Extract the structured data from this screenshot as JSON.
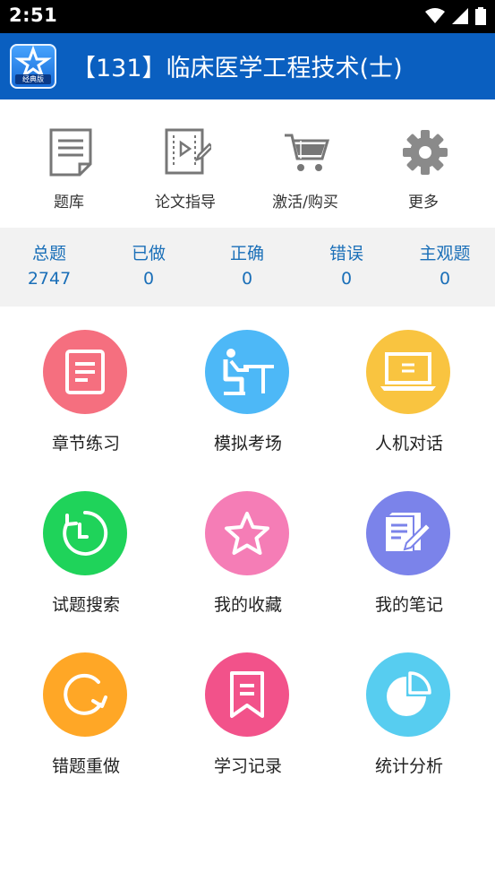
{
  "status_bar": {
    "time": "2:51"
  },
  "app_bar": {
    "title": "【131】临床医学工程技术(士)",
    "logo_badge": "经典版"
  },
  "toolbar": {
    "items": [
      {
        "label": "题库",
        "icon": "question-bank-icon"
      },
      {
        "label": "论文指导",
        "icon": "thesis-guide-icon"
      },
      {
        "label": "激活/购买",
        "icon": "shopping-cart-icon"
      },
      {
        "label": "更多",
        "icon": "gear-icon"
      }
    ]
  },
  "stats": [
    {
      "label": "总题",
      "value": "2747"
    },
    {
      "label": "已做",
      "value": "0"
    },
    {
      "label": "正确",
      "value": "0"
    },
    {
      "label": "错误",
      "value": "0"
    },
    {
      "label": "主观题",
      "value": "0"
    }
  ],
  "grid": {
    "items": [
      {
        "label": "章节练习",
        "icon": "document-icon",
        "color": "#f56f7f"
      },
      {
        "label": "模拟考场",
        "icon": "exam-desk-icon",
        "color": "#4db8f7"
      },
      {
        "label": "人机对话",
        "icon": "laptop-icon",
        "color": "#f9c440"
      },
      {
        "label": "试题搜索",
        "icon": "clock-refresh-icon",
        "color": "#1fd35a"
      },
      {
        "label": "我的收藏",
        "icon": "star-icon",
        "color": "#f57db6"
      },
      {
        "label": "我的笔记",
        "icon": "note-edit-icon",
        "color": "#7b83ea"
      },
      {
        "label": "错题重做",
        "icon": "redo-icon",
        "color": "#ffa726"
      },
      {
        "label": "学习记录",
        "icon": "bookmark-icon",
        "color": "#f2528a"
      },
      {
        "label": "统计分析",
        "icon": "pie-chart-icon",
        "color": "#57cdf0"
      }
    ]
  }
}
